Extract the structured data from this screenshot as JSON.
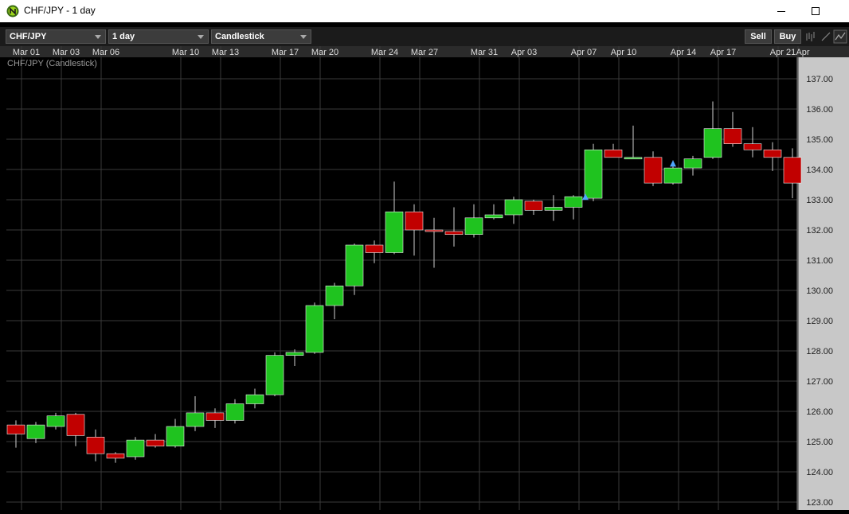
{
  "window": {
    "title": "CHF/JPY - 1 day"
  },
  "toolbar": {
    "symbol": "CHF/JPY",
    "period": "1 day",
    "chart_type": "Candlestick",
    "sell_label": "Sell",
    "buy_label": "Buy"
  },
  "chart_data": {
    "type": "candlestick",
    "title": "CHF/JPY (Candlestick)",
    "up_color": "#1fc31f",
    "down_color": "#c10000",
    "grid": true,
    "ylim": [
      122.8,
      137.5
    ],
    "y_ticks": [
      "123.00",
      "124.00",
      "125.00",
      "126.00",
      "127.00",
      "128.00",
      "129.00",
      "130.00",
      "131.00",
      "132.00",
      "133.00",
      "134.00",
      "135.00",
      "136.00",
      "137.00"
    ],
    "x_labels": [
      {
        "i": 0,
        "label": "Mar 01"
      },
      {
        "i": 2,
        "label": "Mar 03"
      },
      {
        "i": 4,
        "label": "Mar 06"
      },
      {
        "i": 8,
        "label": "Mar 10"
      },
      {
        "i": 10,
        "label": "Mar 13"
      },
      {
        "i": 13,
        "label": "Mar 17"
      },
      {
        "i": 15,
        "label": "Mar 20"
      },
      {
        "i": 18,
        "label": "Mar 24"
      },
      {
        "i": 20,
        "label": "Mar 27"
      },
      {
        "i": 23,
        "label": "Mar 31"
      },
      {
        "i": 25,
        "label": "Apr 03"
      },
      {
        "i": 28,
        "label": "Apr 07"
      },
      {
        "i": 30,
        "label": "Apr 10"
      },
      {
        "i": 33,
        "label": "Apr 14"
      },
      {
        "i": 35,
        "label": "Apr 17"
      },
      {
        "i": 38,
        "label": "Apr 21"
      },
      {
        "i": 39,
        "label": "Apr"
      }
    ],
    "ohlc": [
      [
        125.55,
        125.7,
        124.8,
        125.25
      ],
      [
        125.1,
        125.65,
        124.95,
        125.55
      ],
      [
        125.5,
        125.95,
        125.4,
        125.85
      ],
      [
        125.9,
        125.95,
        124.85,
        125.2
      ],
      [
        125.15,
        125.4,
        124.35,
        124.6
      ],
      [
        124.6,
        124.65,
        124.3,
        124.45
      ],
      [
        124.5,
        125.15,
        124.4,
        125.05
      ],
      [
        125.05,
        125.25,
        124.8,
        124.85
      ],
      [
        124.85,
        125.75,
        124.8,
        125.5
      ],
      [
        125.5,
        126.5,
        125.35,
        125.95
      ],
      [
        125.95,
        126.1,
        125.45,
        125.7
      ],
      [
        125.7,
        126.4,
        125.6,
        126.25
      ],
      [
        126.25,
        126.75,
        126.1,
        126.55
      ],
      [
        126.55,
        127.95,
        126.5,
        127.85
      ],
      [
        127.85,
        128.05,
        127.5,
        127.95
      ],
      [
        127.95,
        129.6,
        127.9,
        129.5
      ],
      [
        129.5,
        130.25,
        129.05,
        130.15
      ],
      [
        130.15,
        131.55,
        129.85,
        131.5
      ],
      [
        131.5,
        131.65,
        130.9,
        131.25
      ],
      [
        131.25,
        133.6,
        131.2,
        132.6
      ],
      [
        132.6,
        132.85,
        131.15,
        132.0
      ],
      [
        132.0,
        132.4,
        130.75,
        131.95
      ],
      [
        131.95,
        132.75,
        131.45,
        131.85
      ],
      [
        131.85,
        132.85,
        131.75,
        132.4
      ],
      [
        132.4,
        132.85,
        132.35,
        132.5
      ],
      [
        132.5,
        133.1,
        132.2,
        133.0
      ],
      [
        132.95,
        133.0,
        132.5,
        132.65
      ],
      [
        132.65,
        133.15,
        132.3,
        132.75
      ],
      [
        132.75,
        133.15,
        132.35,
        133.1
      ],
      [
        133.05,
        134.85,
        132.95,
        134.65
      ],
      [
        134.65,
        134.85,
        134.45,
        134.4
      ],
      [
        134.4,
        135.45,
        134.35,
        134.4
      ],
      [
        134.4,
        134.6,
        133.45,
        133.55
      ],
      [
        133.55,
        134.3,
        133.5,
        134.05
      ],
      [
        134.05,
        134.45,
        133.8,
        134.35
      ],
      [
        134.4,
        136.25,
        134.35,
        135.35
      ],
      [
        135.35,
        135.9,
        134.75,
        134.85
      ],
      [
        134.85,
        135.4,
        134.4,
        134.65
      ],
      [
        134.65,
        134.9,
        133.95,
        134.4
      ],
      [
        134.4,
        134.7,
        133.05,
        133.55
      ]
    ],
    "signals": [
      {
        "i": 29,
        "price": 133.1
      },
      {
        "i": 33,
        "price": 134.2
      }
    ],
    "signal_color": "#4fa6ff"
  }
}
